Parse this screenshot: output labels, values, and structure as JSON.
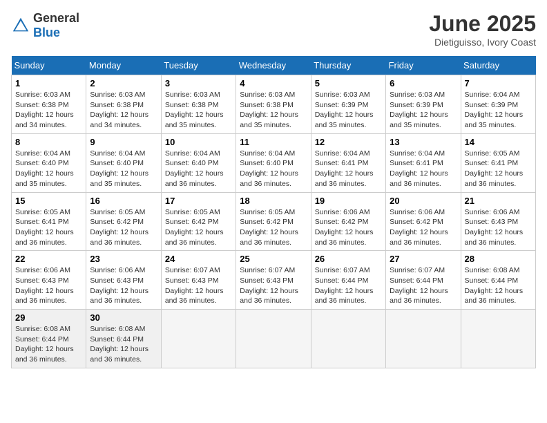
{
  "header": {
    "logo_general": "General",
    "logo_blue": "Blue",
    "month": "June 2025",
    "location": "Dietiguisso, Ivory Coast"
  },
  "days_of_week": [
    "Sunday",
    "Monday",
    "Tuesday",
    "Wednesday",
    "Thursday",
    "Friday",
    "Saturday"
  ],
  "weeks": [
    [
      {
        "day": "1",
        "sunrise": "Sunrise: 6:03 AM",
        "sunset": "Sunset: 6:38 PM",
        "daylight": "Daylight: 12 hours and 34 minutes."
      },
      {
        "day": "2",
        "sunrise": "Sunrise: 6:03 AM",
        "sunset": "Sunset: 6:38 PM",
        "daylight": "Daylight: 12 hours and 34 minutes."
      },
      {
        "day": "3",
        "sunrise": "Sunrise: 6:03 AM",
        "sunset": "Sunset: 6:38 PM",
        "daylight": "Daylight: 12 hours and 35 minutes."
      },
      {
        "day": "4",
        "sunrise": "Sunrise: 6:03 AM",
        "sunset": "Sunset: 6:38 PM",
        "daylight": "Daylight: 12 hours and 35 minutes."
      },
      {
        "day": "5",
        "sunrise": "Sunrise: 6:03 AM",
        "sunset": "Sunset: 6:39 PM",
        "daylight": "Daylight: 12 hours and 35 minutes."
      },
      {
        "day": "6",
        "sunrise": "Sunrise: 6:03 AM",
        "sunset": "Sunset: 6:39 PM",
        "daylight": "Daylight: 12 hours and 35 minutes."
      },
      {
        "day": "7",
        "sunrise": "Sunrise: 6:04 AM",
        "sunset": "Sunset: 6:39 PM",
        "daylight": "Daylight: 12 hours and 35 minutes."
      }
    ],
    [
      {
        "day": "8",
        "sunrise": "Sunrise: 6:04 AM",
        "sunset": "Sunset: 6:40 PM",
        "daylight": "Daylight: 12 hours and 35 minutes."
      },
      {
        "day": "9",
        "sunrise": "Sunrise: 6:04 AM",
        "sunset": "Sunset: 6:40 PM",
        "daylight": "Daylight: 12 hours and 35 minutes."
      },
      {
        "day": "10",
        "sunrise": "Sunrise: 6:04 AM",
        "sunset": "Sunset: 6:40 PM",
        "daylight": "Daylight: 12 hours and 36 minutes."
      },
      {
        "day": "11",
        "sunrise": "Sunrise: 6:04 AM",
        "sunset": "Sunset: 6:40 PM",
        "daylight": "Daylight: 12 hours and 36 minutes."
      },
      {
        "day": "12",
        "sunrise": "Sunrise: 6:04 AM",
        "sunset": "Sunset: 6:41 PM",
        "daylight": "Daylight: 12 hours and 36 minutes."
      },
      {
        "day": "13",
        "sunrise": "Sunrise: 6:04 AM",
        "sunset": "Sunset: 6:41 PM",
        "daylight": "Daylight: 12 hours and 36 minutes."
      },
      {
        "day": "14",
        "sunrise": "Sunrise: 6:05 AM",
        "sunset": "Sunset: 6:41 PM",
        "daylight": "Daylight: 12 hours and 36 minutes."
      }
    ],
    [
      {
        "day": "15",
        "sunrise": "Sunrise: 6:05 AM",
        "sunset": "Sunset: 6:41 PM",
        "daylight": "Daylight: 12 hours and 36 minutes."
      },
      {
        "day": "16",
        "sunrise": "Sunrise: 6:05 AM",
        "sunset": "Sunset: 6:42 PM",
        "daylight": "Daylight: 12 hours and 36 minutes."
      },
      {
        "day": "17",
        "sunrise": "Sunrise: 6:05 AM",
        "sunset": "Sunset: 6:42 PM",
        "daylight": "Daylight: 12 hours and 36 minutes."
      },
      {
        "day": "18",
        "sunrise": "Sunrise: 6:05 AM",
        "sunset": "Sunset: 6:42 PM",
        "daylight": "Daylight: 12 hours and 36 minutes."
      },
      {
        "day": "19",
        "sunrise": "Sunrise: 6:06 AM",
        "sunset": "Sunset: 6:42 PM",
        "daylight": "Daylight: 12 hours and 36 minutes."
      },
      {
        "day": "20",
        "sunrise": "Sunrise: 6:06 AM",
        "sunset": "Sunset: 6:42 PM",
        "daylight": "Daylight: 12 hours and 36 minutes."
      },
      {
        "day": "21",
        "sunrise": "Sunrise: 6:06 AM",
        "sunset": "Sunset: 6:43 PM",
        "daylight": "Daylight: 12 hours and 36 minutes."
      }
    ],
    [
      {
        "day": "22",
        "sunrise": "Sunrise: 6:06 AM",
        "sunset": "Sunset: 6:43 PM",
        "daylight": "Daylight: 12 hours and 36 minutes."
      },
      {
        "day": "23",
        "sunrise": "Sunrise: 6:06 AM",
        "sunset": "Sunset: 6:43 PM",
        "daylight": "Daylight: 12 hours and 36 minutes."
      },
      {
        "day": "24",
        "sunrise": "Sunrise: 6:07 AM",
        "sunset": "Sunset: 6:43 PM",
        "daylight": "Daylight: 12 hours and 36 minutes."
      },
      {
        "day": "25",
        "sunrise": "Sunrise: 6:07 AM",
        "sunset": "Sunset: 6:43 PM",
        "daylight": "Daylight: 12 hours and 36 minutes."
      },
      {
        "day": "26",
        "sunrise": "Sunrise: 6:07 AM",
        "sunset": "Sunset: 6:44 PM",
        "daylight": "Daylight: 12 hours and 36 minutes."
      },
      {
        "day": "27",
        "sunrise": "Sunrise: 6:07 AM",
        "sunset": "Sunset: 6:44 PM",
        "daylight": "Daylight: 12 hours and 36 minutes."
      },
      {
        "day": "28",
        "sunrise": "Sunrise: 6:08 AM",
        "sunset": "Sunset: 6:44 PM",
        "daylight": "Daylight: 12 hours and 36 minutes."
      }
    ],
    [
      {
        "day": "29",
        "sunrise": "Sunrise: 6:08 AM",
        "sunset": "Sunset: 6:44 PM",
        "daylight": "Daylight: 12 hours and 36 minutes."
      },
      {
        "day": "30",
        "sunrise": "Sunrise: 6:08 AM",
        "sunset": "Sunset: 6:44 PM",
        "daylight": "Daylight: 12 hours and 36 minutes."
      },
      {
        "day": "",
        "sunrise": "",
        "sunset": "",
        "daylight": ""
      },
      {
        "day": "",
        "sunrise": "",
        "sunset": "",
        "daylight": ""
      },
      {
        "day": "",
        "sunrise": "",
        "sunset": "",
        "daylight": ""
      },
      {
        "day": "",
        "sunrise": "",
        "sunset": "",
        "daylight": ""
      },
      {
        "day": "",
        "sunrise": "",
        "sunset": "",
        "daylight": ""
      }
    ]
  ]
}
